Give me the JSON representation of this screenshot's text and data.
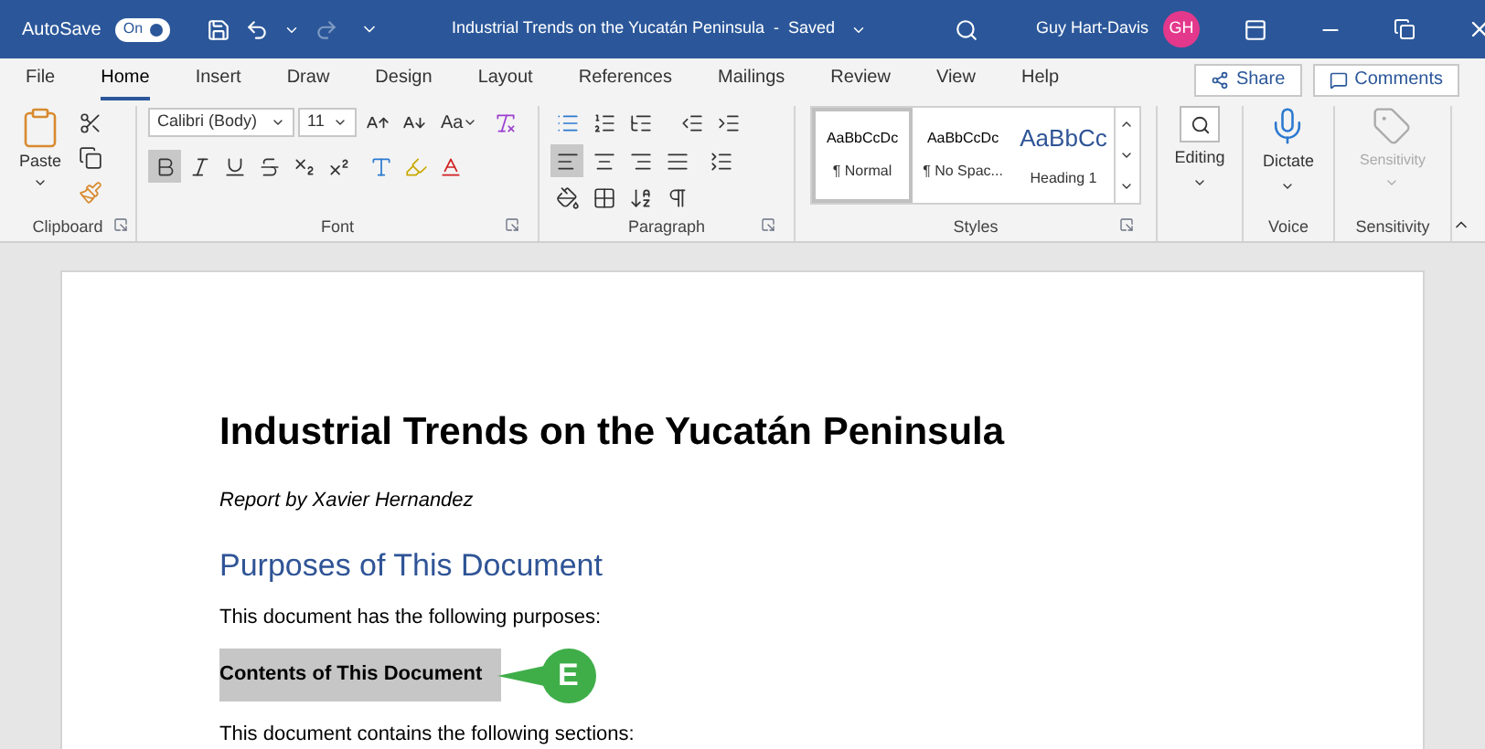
{
  "title_bar": {
    "autosave_label": "AutoSave",
    "autosave_toggle": {
      "label": "On",
      "on": true
    },
    "document_title": "Industrial Trends on the Yucatán Peninsula  -  Saved",
    "user_name": "Guy Hart-Davis",
    "user_initials": "GH"
  },
  "menu_tabs": [
    {
      "label": "File",
      "selected": false
    },
    {
      "label": "Home",
      "selected": true
    },
    {
      "label": "Insert",
      "selected": false
    },
    {
      "label": "Draw",
      "selected": false
    },
    {
      "label": "Design",
      "selected": false
    },
    {
      "label": "Layout",
      "selected": false
    },
    {
      "label": "References",
      "selected": false
    },
    {
      "label": "Mailings",
      "selected": false
    },
    {
      "label": "Review",
      "selected": false
    },
    {
      "label": "View",
      "selected": false
    },
    {
      "label": "Help",
      "selected": false
    }
  ],
  "share_button": "Share",
  "comments_button": "Comments",
  "ribbon": {
    "clipboard": {
      "paste": "Paste",
      "label": "Clipboard"
    },
    "font": {
      "font_name": "Calibri (Body)",
      "font_size": "11",
      "change_case": "Aa",
      "bold_on": true,
      "label": "Font"
    },
    "paragraph": {
      "align_left_on": true,
      "label": "Paragraph"
    },
    "styles": {
      "items": [
        {
          "sample": "AaBbCcDc",
          "name": "¶ Normal",
          "kind": "body",
          "selected": true
        },
        {
          "sample": "AaBbCcDc",
          "name": "¶ No Spac...",
          "kind": "body",
          "selected": false
        },
        {
          "sample": "AaBbCc",
          "name": "Heading 1",
          "kind": "heading",
          "selected": false
        }
      ],
      "label": "Styles"
    },
    "editing": {
      "button": "Editing"
    },
    "voice": {
      "button": "Dictate",
      "label": "Voice"
    },
    "sensitivity": {
      "button": "Sensitivity",
      "label": "Sensitivity",
      "disabled": true
    }
  },
  "document": {
    "blocks": [
      {
        "kind": "title",
        "text": "Industrial Trends on the Yucatán Peninsula",
        "selected": false
      },
      {
        "kind": "byline",
        "text": "Report by Xavier Hernandez",
        "selected": false
      },
      {
        "kind": "heading",
        "text": "Purposes of This Document",
        "selected": false
      },
      {
        "kind": "body",
        "text": "This document has the following purposes:",
        "selected": false
      },
      {
        "kind": "strong",
        "text": "Contents of This Document",
        "selected": true
      },
      {
        "kind": "body",
        "text": "This document contains the following sections:",
        "selected": false
      }
    ],
    "callout": {
      "label": "E"
    }
  }
}
